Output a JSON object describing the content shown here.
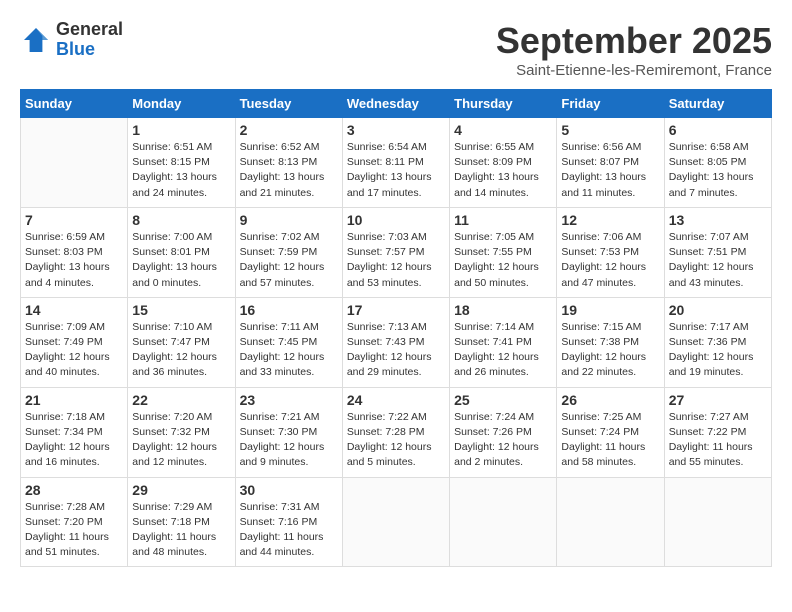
{
  "header": {
    "logo_general": "General",
    "logo_blue": "Blue",
    "month": "September 2025",
    "location": "Saint-Etienne-les-Remiremont, France"
  },
  "weekdays": [
    "Sunday",
    "Monday",
    "Tuesday",
    "Wednesday",
    "Thursday",
    "Friday",
    "Saturday"
  ],
  "weeks": [
    [
      {
        "day": "",
        "info": ""
      },
      {
        "day": "1",
        "info": "Sunrise: 6:51 AM\nSunset: 8:15 PM\nDaylight: 13 hours\nand 24 minutes."
      },
      {
        "day": "2",
        "info": "Sunrise: 6:52 AM\nSunset: 8:13 PM\nDaylight: 13 hours\nand 21 minutes."
      },
      {
        "day": "3",
        "info": "Sunrise: 6:54 AM\nSunset: 8:11 PM\nDaylight: 13 hours\nand 17 minutes."
      },
      {
        "day": "4",
        "info": "Sunrise: 6:55 AM\nSunset: 8:09 PM\nDaylight: 13 hours\nand 14 minutes."
      },
      {
        "day": "5",
        "info": "Sunrise: 6:56 AM\nSunset: 8:07 PM\nDaylight: 13 hours\nand 11 minutes."
      },
      {
        "day": "6",
        "info": "Sunrise: 6:58 AM\nSunset: 8:05 PM\nDaylight: 13 hours\nand 7 minutes."
      }
    ],
    [
      {
        "day": "7",
        "info": "Sunrise: 6:59 AM\nSunset: 8:03 PM\nDaylight: 13 hours\nand 4 minutes."
      },
      {
        "day": "8",
        "info": "Sunrise: 7:00 AM\nSunset: 8:01 PM\nDaylight: 13 hours\nand 0 minutes."
      },
      {
        "day": "9",
        "info": "Sunrise: 7:02 AM\nSunset: 7:59 PM\nDaylight: 12 hours\nand 57 minutes."
      },
      {
        "day": "10",
        "info": "Sunrise: 7:03 AM\nSunset: 7:57 PM\nDaylight: 12 hours\nand 53 minutes."
      },
      {
        "day": "11",
        "info": "Sunrise: 7:05 AM\nSunset: 7:55 PM\nDaylight: 12 hours\nand 50 minutes."
      },
      {
        "day": "12",
        "info": "Sunrise: 7:06 AM\nSunset: 7:53 PM\nDaylight: 12 hours\nand 47 minutes."
      },
      {
        "day": "13",
        "info": "Sunrise: 7:07 AM\nSunset: 7:51 PM\nDaylight: 12 hours\nand 43 minutes."
      }
    ],
    [
      {
        "day": "14",
        "info": "Sunrise: 7:09 AM\nSunset: 7:49 PM\nDaylight: 12 hours\nand 40 minutes."
      },
      {
        "day": "15",
        "info": "Sunrise: 7:10 AM\nSunset: 7:47 PM\nDaylight: 12 hours\nand 36 minutes."
      },
      {
        "day": "16",
        "info": "Sunrise: 7:11 AM\nSunset: 7:45 PM\nDaylight: 12 hours\nand 33 minutes."
      },
      {
        "day": "17",
        "info": "Sunrise: 7:13 AM\nSunset: 7:43 PM\nDaylight: 12 hours\nand 29 minutes."
      },
      {
        "day": "18",
        "info": "Sunrise: 7:14 AM\nSunset: 7:41 PM\nDaylight: 12 hours\nand 26 minutes."
      },
      {
        "day": "19",
        "info": "Sunrise: 7:15 AM\nSunset: 7:38 PM\nDaylight: 12 hours\nand 22 minutes."
      },
      {
        "day": "20",
        "info": "Sunrise: 7:17 AM\nSunset: 7:36 PM\nDaylight: 12 hours\nand 19 minutes."
      }
    ],
    [
      {
        "day": "21",
        "info": "Sunrise: 7:18 AM\nSunset: 7:34 PM\nDaylight: 12 hours\nand 16 minutes."
      },
      {
        "day": "22",
        "info": "Sunrise: 7:20 AM\nSunset: 7:32 PM\nDaylight: 12 hours\nand 12 minutes."
      },
      {
        "day": "23",
        "info": "Sunrise: 7:21 AM\nSunset: 7:30 PM\nDaylight: 12 hours\nand 9 minutes."
      },
      {
        "day": "24",
        "info": "Sunrise: 7:22 AM\nSunset: 7:28 PM\nDaylight: 12 hours\nand 5 minutes."
      },
      {
        "day": "25",
        "info": "Sunrise: 7:24 AM\nSunset: 7:26 PM\nDaylight: 12 hours\nand 2 minutes."
      },
      {
        "day": "26",
        "info": "Sunrise: 7:25 AM\nSunset: 7:24 PM\nDaylight: 11 hours\nand 58 minutes."
      },
      {
        "day": "27",
        "info": "Sunrise: 7:27 AM\nSunset: 7:22 PM\nDaylight: 11 hours\nand 55 minutes."
      }
    ],
    [
      {
        "day": "28",
        "info": "Sunrise: 7:28 AM\nSunset: 7:20 PM\nDaylight: 11 hours\nand 51 minutes."
      },
      {
        "day": "29",
        "info": "Sunrise: 7:29 AM\nSunset: 7:18 PM\nDaylight: 11 hours\nand 48 minutes."
      },
      {
        "day": "30",
        "info": "Sunrise: 7:31 AM\nSunset: 7:16 PM\nDaylight: 11 hours\nand 44 minutes."
      },
      {
        "day": "",
        "info": ""
      },
      {
        "day": "",
        "info": ""
      },
      {
        "day": "",
        "info": ""
      },
      {
        "day": "",
        "info": ""
      }
    ]
  ]
}
